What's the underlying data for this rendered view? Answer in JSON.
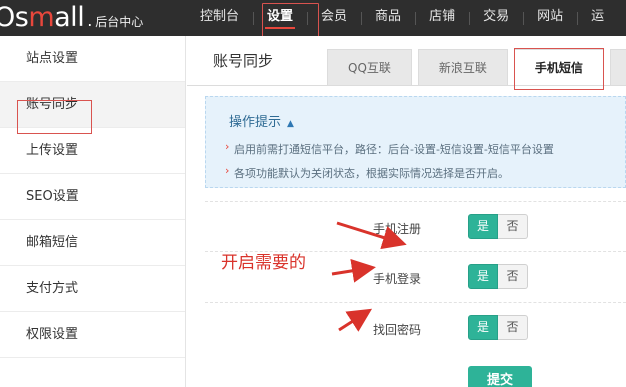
{
  "logo": {
    "main_pre": "Os",
    "main_accent": "m",
    "main_post": "all",
    "dot": ".",
    "sub": "后台中心"
  },
  "nav": {
    "items": [
      {
        "label": "控制台"
      },
      {
        "label": "设置"
      },
      {
        "label": "会员"
      },
      {
        "label": "商品"
      },
      {
        "label": "店铺"
      },
      {
        "label": "交易"
      },
      {
        "label": "网站"
      },
      {
        "label": "运"
      }
    ],
    "active": "设置"
  },
  "sidebar": {
    "items": [
      {
        "label": "站点设置"
      },
      {
        "label": "账号同步"
      },
      {
        "label": "上传设置"
      },
      {
        "label": "SEO设置"
      },
      {
        "label": "邮箱短信"
      },
      {
        "label": "支付方式"
      },
      {
        "label": "权限设置"
      }
    ],
    "active": "账号同步"
  },
  "page": {
    "title": "账号同步"
  },
  "tabs": [
    {
      "label": "QQ互联"
    },
    {
      "label": "新浪互联"
    },
    {
      "label": "手机短信"
    }
  ],
  "active_tab": "手机短信",
  "tips": {
    "title": "操作提示",
    "caret": "▲",
    "lines": [
      "启用前需打通短信平台，路径：后台-设置-短信设置-短信平台设置",
      "各项功能默认为关闭状态，根据实际情况选择是否开启。"
    ]
  },
  "settings": [
    {
      "label": "手机注册",
      "yes": "是",
      "no": "否",
      "value": "是"
    },
    {
      "label": "手机登录",
      "yes": "是",
      "no": "否",
      "value": "是"
    },
    {
      "label": "找回密码",
      "yes": "是",
      "no": "否",
      "value": "是"
    }
  ],
  "annotation": "开启需要的",
  "submit_label": "提交",
  "colors": {
    "topbar": "#2e2e2e",
    "accent": "#e8473c",
    "toggle_on": "#2eb398",
    "annotation": "#d9332b",
    "tips_bg": "#e6f2fb"
  }
}
